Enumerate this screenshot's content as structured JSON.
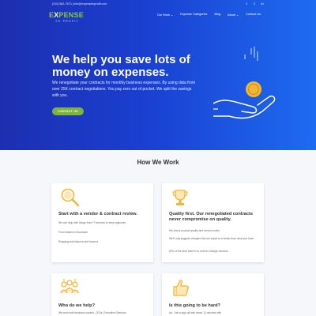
{
  "topbar": {
    "contact": "(310) 882-7673 | info@expensetoprofit.com",
    "social_icons": [
      "facebook-icon",
      "twitter-icon",
      "linkedin-icon"
    ]
  },
  "logo": {
    "part1": "E",
    "part2": "X",
    "part3": "PENSE",
    "tagline": "TO PROFIT"
  },
  "nav": {
    "items": [
      {
        "label": "Our Work ⌄"
      },
      {
        "label": "Expense Categories"
      },
      {
        "label": "Blog"
      },
      {
        "label": "About ⌄"
      },
      {
        "label": "Contact Us"
      }
    ]
  },
  "hero": {
    "title": "We help you save lots of money on expenses.",
    "text": "We renegotiate your contracts for monthly business expenses. By using data from over 25K contract negotiations. You pay zero out of pocket. We split the savings with you.",
    "cta_label": "CONTACT US"
  },
  "how_we_work": {
    "title": "How We Work",
    "cards": [
      {
        "icon": "magnifier-icon",
        "title": "Start with a vendor & contract review.",
        "paragraphs": [
          "We can help with things from IT services to temp agencies",
          "From leases to insurance",
          "Shipping and telecom and beyond"
        ]
      },
      {
        "icon": "trophy-icon",
        "title": "Quality first. Our renegotiated contracts never compromise on quality.",
        "paragraphs": [
          "We check product quality and service levels",
          "We'll only suggest changes that are equal to or better than what you have",
          "80% of the time there's no need to change vendors"
        ]
      },
      {
        "icon": "team-icon",
        "title": "Who do we help?",
        "paragraphs": [
          "We work with business owners, CFOs, Executive Directors"
        ]
      },
      {
        "icon": "thumbs-up-icon",
        "title": "Is this going to be hard?",
        "paragraphs": [
          "No. Just a sign off with about 10 minutes with"
        ]
      }
    ]
  },
  "colors": {
    "hero_start": "#1d2fb0",
    "hero_end": "#1e6bf0",
    "accent_green": "#7cb53a",
    "icon_gold": "#f2b632"
  }
}
